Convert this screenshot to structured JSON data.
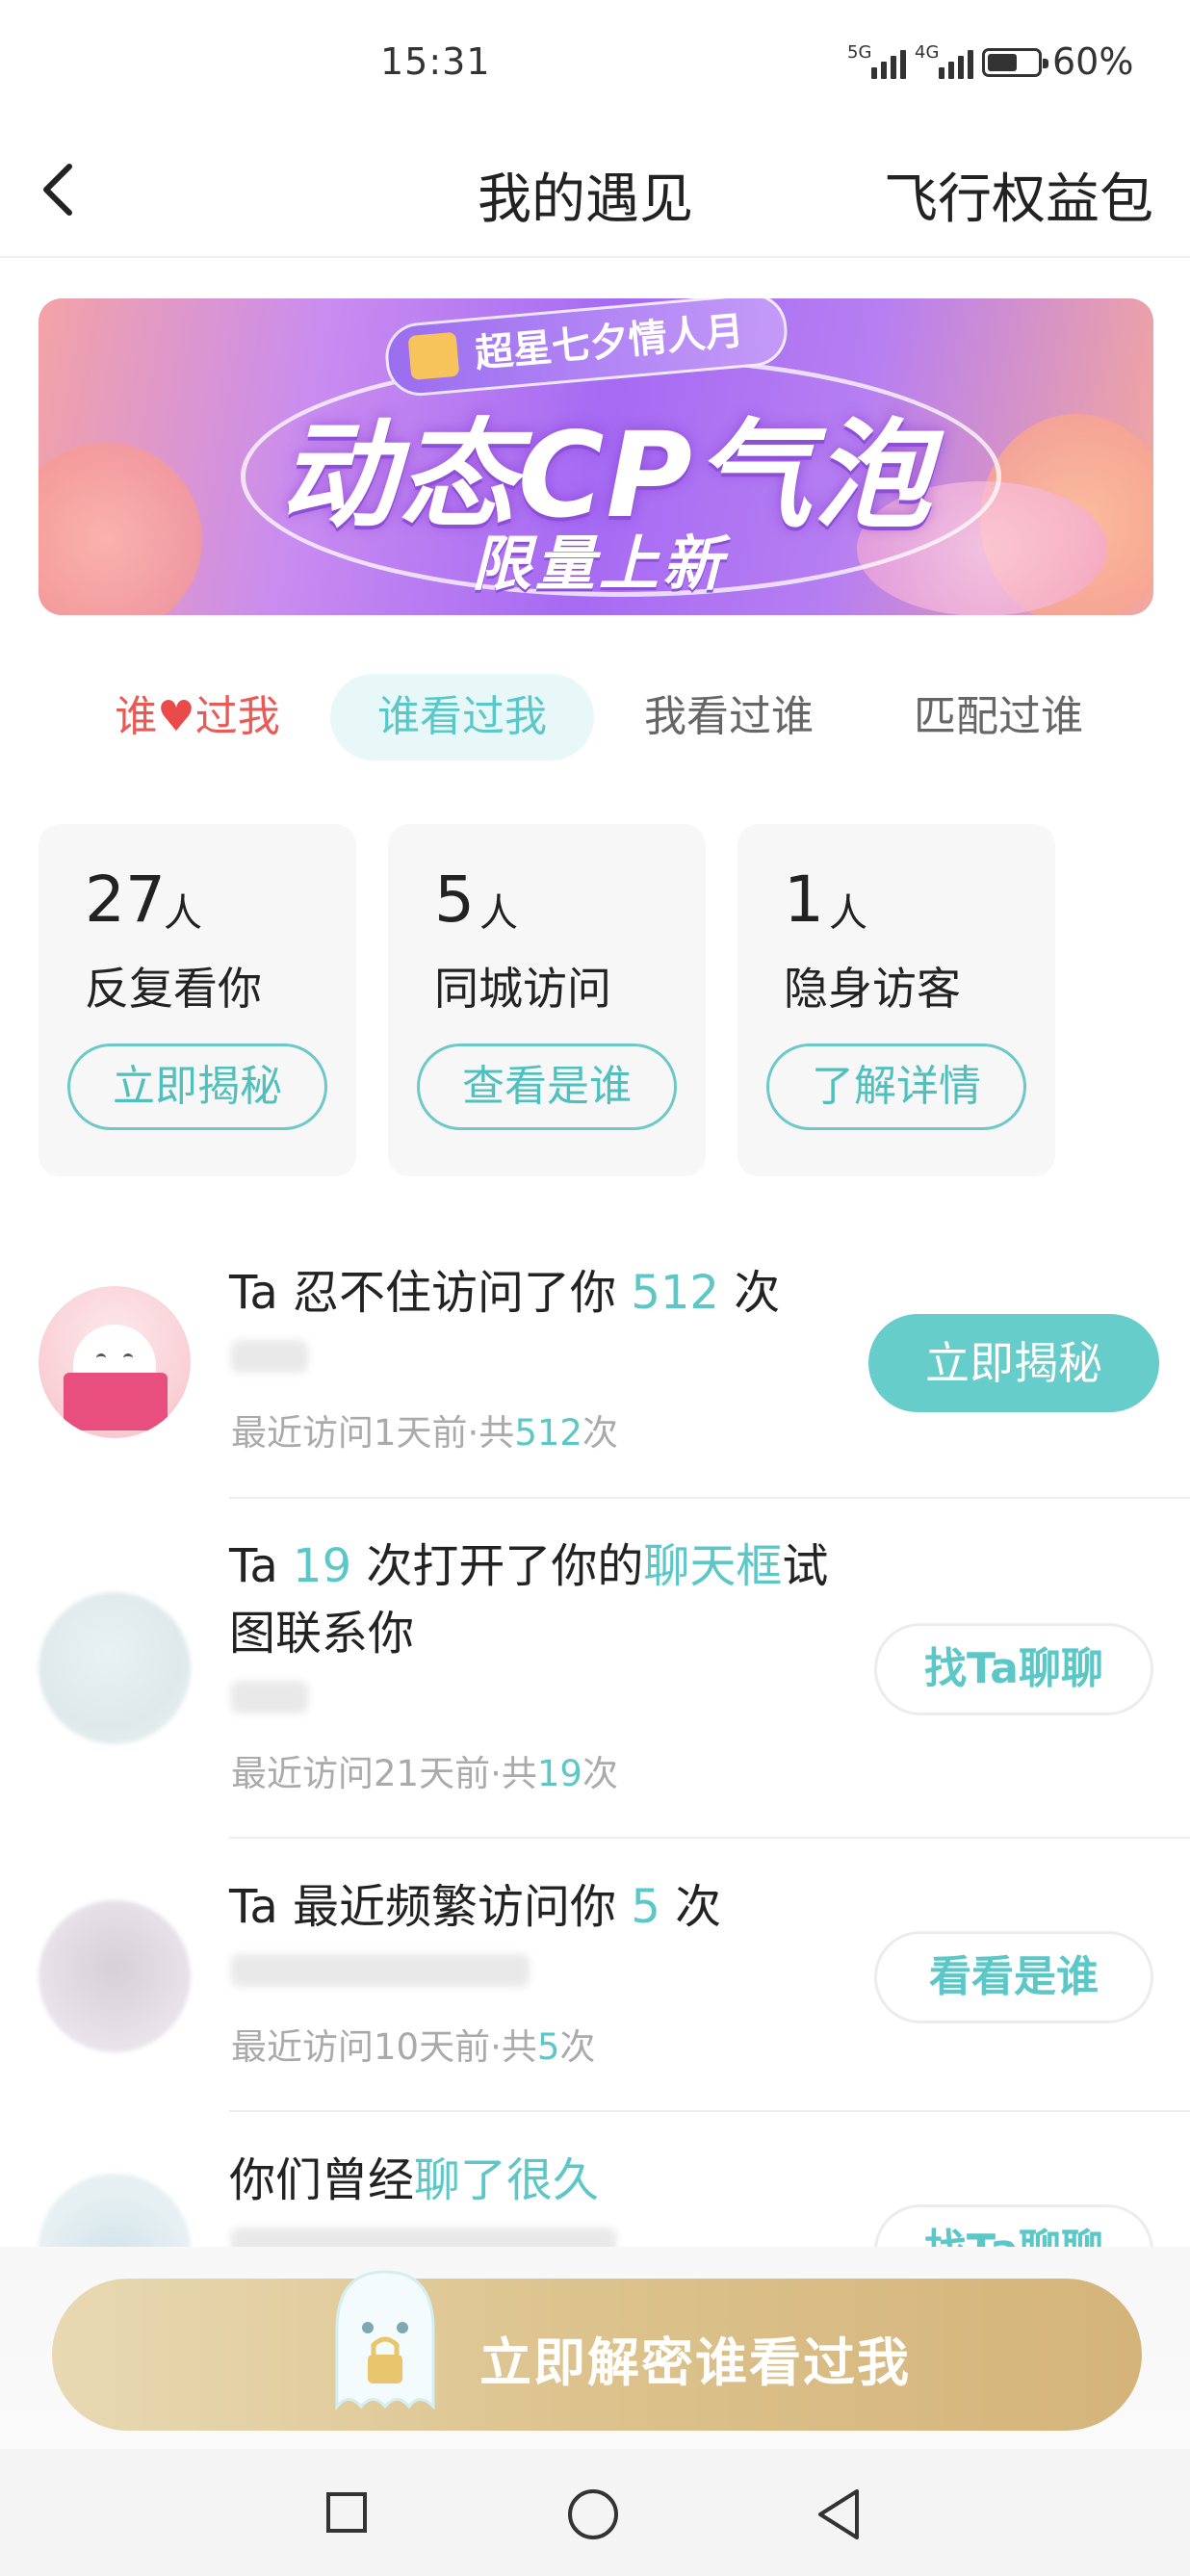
{
  "status_bar": {
    "time": "15:31",
    "signal_1": "5G",
    "signal_2": "4G",
    "battery": "60%"
  },
  "nav": {
    "title": "我的遇见",
    "right_link": "飞行权益包"
  },
  "banner": {
    "tag": "超星七夕情人月",
    "title": "动态CP气泡",
    "subtitle": "限量上新"
  },
  "tabs": [
    {
      "pre": "谁",
      "post": "过我",
      "icon": "heart-icon"
    },
    {
      "label": "谁看过我"
    },
    {
      "label": "我看过谁"
    },
    {
      "label": "匹配过谁"
    }
  ],
  "cards": [
    {
      "count": "27",
      "unit": "人",
      "desc": "反复看你",
      "button": "立即揭秘"
    },
    {
      "count": "5",
      "unit": "人",
      "desc": "同城访问",
      "button": "查看是谁"
    },
    {
      "count": "1",
      "unit": "人",
      "desc": "隐身访客",
      "button": "了解详情"
    }
  ],
  "visitors": [
    {
      "t1": "Ta 忍不住访问了你 ",
      "hl1": "512",
      "t2": " 次",
      "meta_pre": "最近访问1天前·共",
      "meta_num": "512",
      "meta_post": "次",
      "button": "立即揭秘"
    },
    {
      "t1": "Ta ",
      "hl1": "19",
      "t2": " 次打开了你的",
      "hl2": "聊天框",
      "t3": "试",
      "t4": "图联系你",
      "meta_pre": "最近访问21天前·共",
      "meta_num": "19",
      "meta_post": "次",
      "button": "找Ta聊聊"
    },
    {
      "t1": "Ta 最近频繁访问你 ",
      "hl1": "5",
      "t2": " 次",
      "meta_pre": "最近访问10天前·共",
      "meta_num": "5",
      "meta_post": "次",
      "button": "看看是谁"
    },
    {
      "t1": "你们曾经",
      "hl1": "聊了很久",
      "button": "找Ta聊聊"
    }
  ],
  "cta": {
    "label": "立即解密谁看过我"
  },
  "colors": {
    "accent": "#5cc7c7",
    "liked": "#ea5a55",
    "cta_gold": "#d9bb82"
  }
}
